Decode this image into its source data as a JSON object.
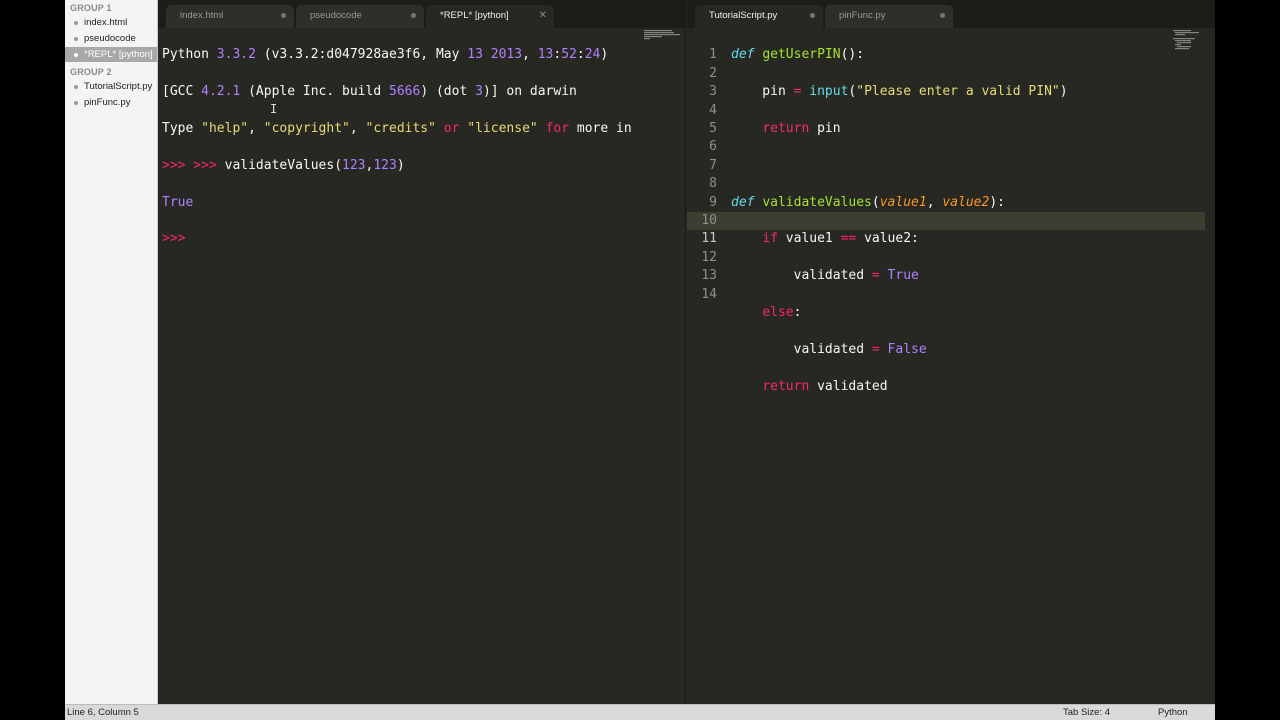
{
  "sidebar": {
    "groups": [
      {
        "title": "GROUP 1",
        "files": [
          "index.html",
          "pseudocode",
          "*REPL* [python]"
        ]
      },
      {
        "title": "GROUP 2",
        "files": [
          "TutorialScript.py",
          "pinFunc.py"
        ]
      }
    ]
  },
  "left_tabs": [
    "index.html",
    "pseudocode",
    "*REPL* [python]"
  ],
  "right_tabs": [
    "TutorialScript.py",
    "pinFunc.py"
  ],
  "repl": {
    "line1": [
      "Python ",
      "3.3.2",
      " (v3.3.2:d047928ae3f6, May ",
      "13",
      " ",
      "2013",
      ", ",
      "13",
      ":",
      "52",
      ":",
      "24",
      ")"
    ],
    "line2": [
      "[GCC ",
      "4.2.1",
      " (Apple Inc. build ",
      "5666",
      ") (dot ",
      "3",
      ")] on darwin"
    ],
    "line3": [
      "Type ",
      "\"help\"",
      ", ",
      "\"copyright\"",
      ", ",
      "\"credits\"",
      " ",
      "or",
      " ",
      "\"license\"",
      " ",
      "for",
      " more in"
    ],
    "line4": [
      ">>> >>> ",
      "validateValues(",
      "123",
      ",",
      "123",
      ")"
    ],
    "line5": "True",
    "line6": ">>>"
  },
  "script": {
    "line_numbers": [
      "1",
      "2",
      "3",
      "4",
      "5",
      "6",
      "7",
      "8",
      "9",
      "10",
      "11",
      "12",
      "13",
      "14"
    ],
    "l1": [
      "def",
      " ",
      "getUserPIN",
      "():"
    ],
    "l2": [
      "    pin ",
      "=",
      " ",
      "input",
      "(",
      "\"Please enter a valid PIN\"",
      ")"
    ],
    "l3": [
      "    ",
      "return",
      " pin"
    ],
    "l5": [
      "def",
      " ",
      "validateValues",
      "(",
      "value1",
      ", ",
      "value2",
      "):"
    ],
    "l6": [
      "    ",
      "if",
      " value1 ",
      "==",
      " value2:"
    ],
    "l7": [
      "        validated ",
      "=",
      " ",
      "True"
    ],
    "l8": [
      "    ",
      "else",
      ":"
    ],
    "l9": [
      "        validated ",
      "=",
      " ",
      "False"
    ],
    "l10": [
      "    ",
      "return",
      " validated"
    ]
  },
  "status": {
    "position": "Line 6, Column 5",
    "tab_size": "Tab Size: 4",
    "syntax": "Python"
  }
}
